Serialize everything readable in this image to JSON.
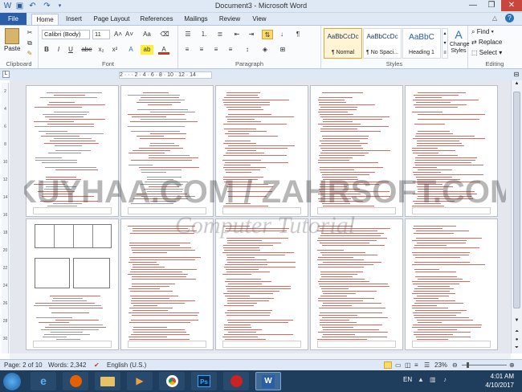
{
  "window": {
    "title": "Document3 - Microsoft Word"
  },
  "quick_access": [
    "save-icon",
    "undo-icon",
    "redo-icon"
  ],
  "tabs": [
    "File",
    "Home",
    "Insert",
    "Page Layout",
    "References",
    "Mailings",
    "Review",
    "View"
  ],
  "ribbon": {
    "clipboard": {
      "label": "Clipboard",
      "paste": "Paste"
    },
    "font": {
      "label": "Font",
      "family": "Calibri (Body)",
      "size": "11",
      "buttons": [
        "B",
        "I",
        "U",
        "abe",
        "x₂",
        "x²",
        "A"
      ]
    },
    "paragraph": {
      "label": "Paragraph",
      "pilcrow": "¶"
    },
    "styles": {
      "label": "Styles",
      "items": [
        {
          "preview": "AaBbCcDc",
          "name": "¶ Normal"
        },
        {
          "preview": "AaBbCcDc",
          "name": "¶ No Spaci..."
        },
        {
          "preview": "AaBbC",
          "name": "Heading 1"
        }
      ],
      "change": "Change Styles"
    },
    "editing": {
      "label": "Editing",
      "find": "Find",
      "replace": "Replace",
      "select": "Select"
    }
  },
  "ruler": {
    "marks": "2 · · · 2 · 4 · 6 · 8 · 10 · 12 · 14"
  },
  "vruler": {
    "marks": [
      "2",
      "4",
      "6",
      "8",
      "10",
      "12",
      "14",
      "16",
      "18",
      "20",
      "22",
      "24",
      "26",
      "28",
      "30"
    ]
  },
  "watermark": {
    "line1": "KUYHAA.COM / ZAHRSOFT.COM",
    "line2": "Computer Tutorial"
  },
  "status": {
    "page": "Page: 2 of 10",
    "words": "Words: 2,342",
    "language": "English (U.S.)",
    "zoom": "23%"
  },
  "taskbar": {
    "lang": "EN",
    "time": "4:01 AM",
    "date": "4/10/2017"
  }
}
